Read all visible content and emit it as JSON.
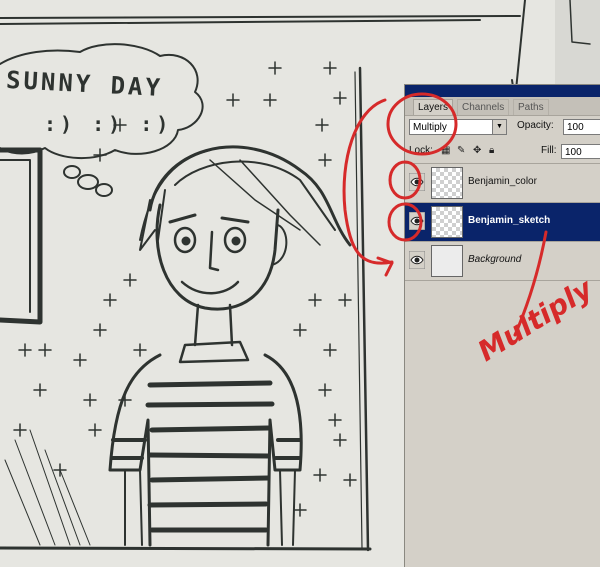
{
  "illustration": {
    "thought_bubble_text": "SUNNY DAY",
    "thought_bubble_smileys": ":) :) :)"
  },
  "layers_panel": {
    "tabs": [
      {
        "label": "Layers",
        "active": true
      },
      {
        "label": "Channels",
        "active": false
      },
      {
        "label": "Paths",
        "active": false
      }
    ],
    "blend_mode": "Multiply",
    "opacity_label": "Opacity:",
    "opacity_value": "100",
    "lock_label": "Lock:",
    "fill_label": "Fill:",
    "fill_value": "100",
    "lock_icons": [
      "transparency-lock-icon",
      "brush-lock-icon",
      "move-lock-icon",
      "padlock-icon"
    ],
    "layers": [
      {
        "name": "Benjamin_color",
        "visible": true,
        "selected": false,
        "thumbnail": "transparent"
      },
      {
        "name": "Benjamin_sketch",
        "visible": true,
        "selected": true,
        "thumbnail": "transparent"
      },
      {
        "name": "Background",
        "visible": true,
        "selected": false,
        "thumbnail": "plain",
        "italic": true
      }
    ]
  },
  "annotation": {
    "handwritten_text": "Multiply",
    "color": "#d62a2a"
  },
  "colors": {
    "panel_bg": "#d4d0c8",
    "selection": "#0a246a",
    "sketch_line": "#2e3330",
    "paper": "#e6e6e1"
  }
}
